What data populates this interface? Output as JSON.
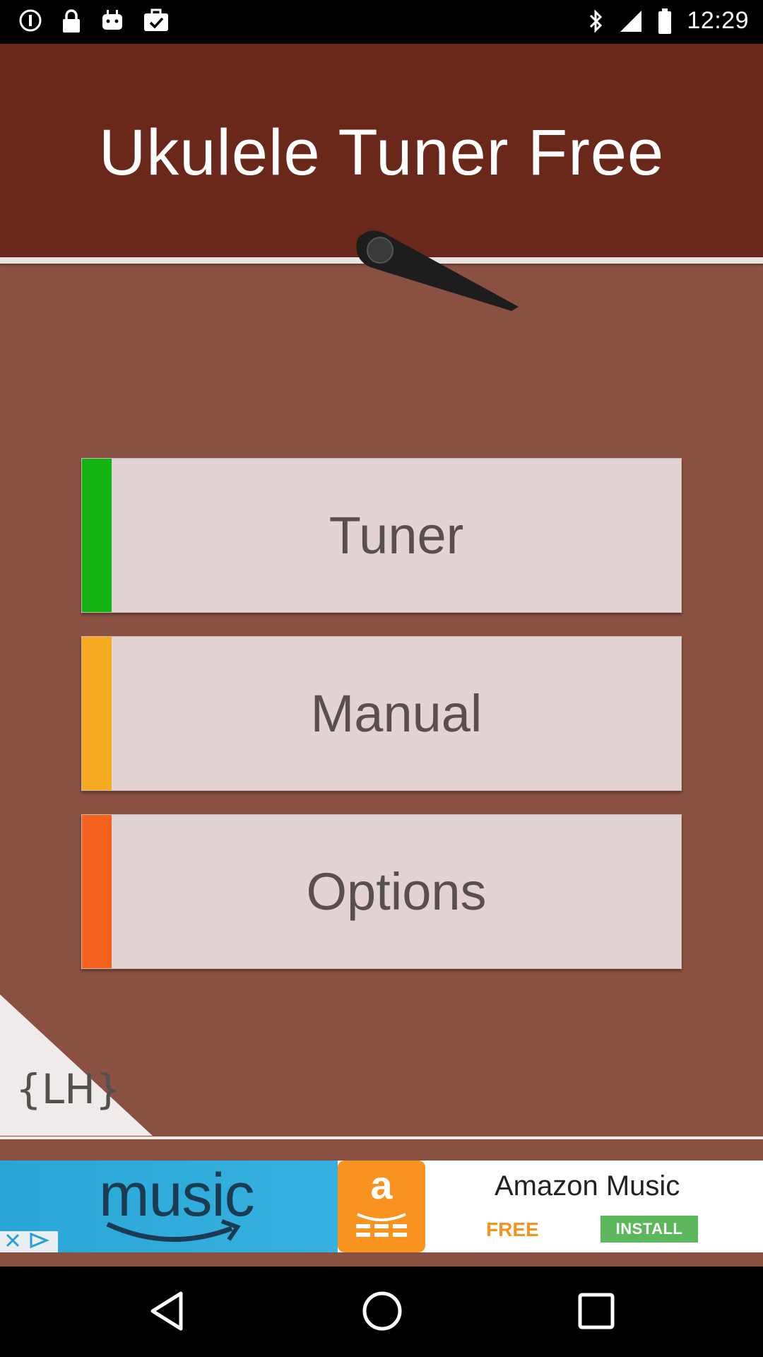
{
  "status_bar": {
    "time": "12:29",
    "icons": [
      "notification-circle-icon",
      "lock-icon",
      "android-icon",
      "briefcase-check-icon",
      "bluetooth-icon",
      "signal-icon",
      "battery-icon"
    ]
  },
  "app": {
    "title": "Ukulele Tuner Free",
    "menu": [
      {
        "label": "Tuner",
        "stripe_color": "#12b412"
      },
      {
        "label": "Manual",
        "stripe_color": "#f6aa22"
      },
      {
        "label": "Options",
        "stripe_color": "#f4621e"
      }
    ],
    "corner_logo_text": "{LH}"
  },
  "ad": {
    "brand_word": "music",
    "app_name": "Amazon Music",
    "price": "FREE",
    "cta": "INSTALL",
    "icon_letter": "a"
  },
  "colors": {
    "header_bg": "#6a281a",
    "body_bg": "#8a5142",
    "button_bg": "#e2d4d2"
  },
  "nav_bar": {
    "icons": [
      "back-icon",
      "home-icon",
      "recent-apps-icon"
    ]
  }
}
